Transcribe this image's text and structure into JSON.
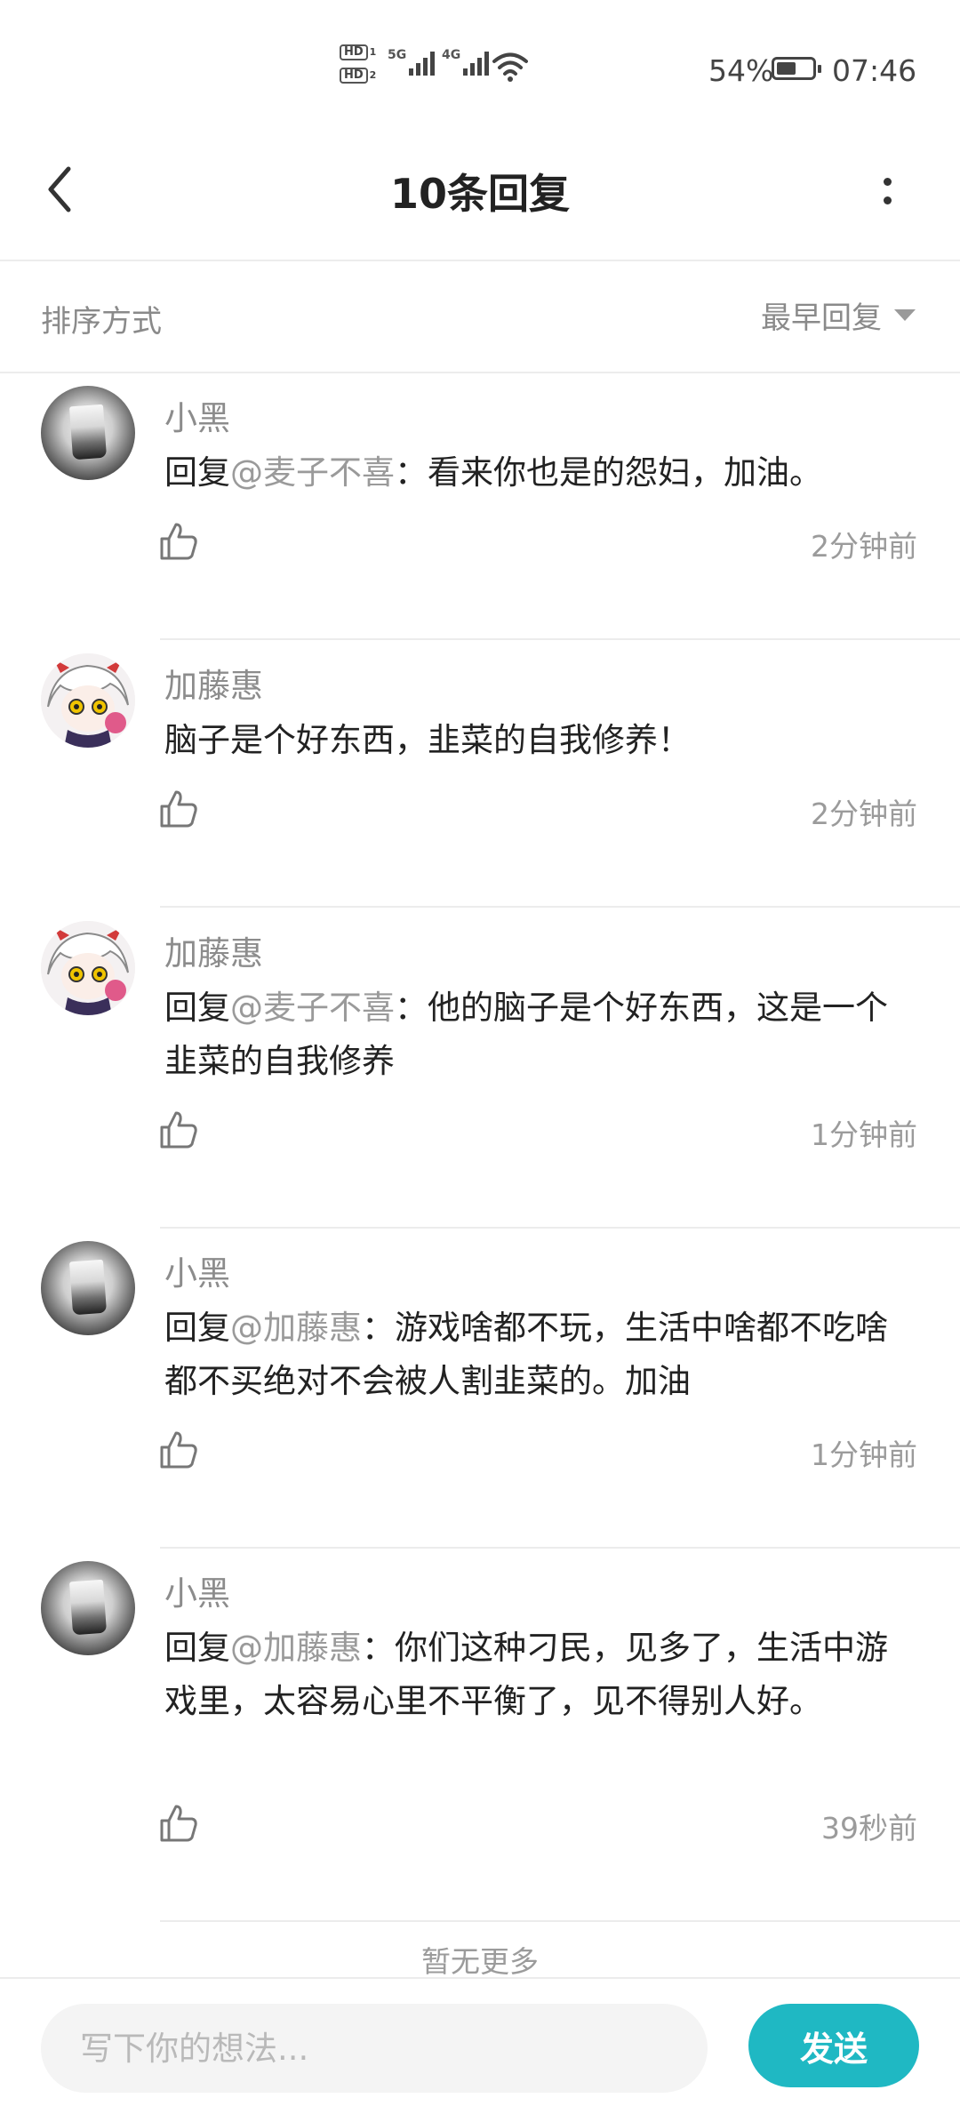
{
  "status_bar": {
    "hd1": "HD",
    "hd1_sub": "1",
    "hd2": "HD",
    "hd2_sub": "2",
    "network1": "5G",
    "network2": "4G",
    "battery_percent": "54%",
    "battery_level": 0.54,
    "time": "07:46"
  },
  "header": {
    "title": "10条回复",
    "back_icon": "chevron-left-icon",
    "more_icon": "more-vertical-icon"
  },
  "sort": {
    "label": "排序方式",
    "selected": "最早回复"
  },
  "comments": [
    {
      "name": "小黑",
      "avatar": "glass",
      "prefix": "回复",
      "mention": "@麦子不喜",
      "text": "：看来你也是的怨妇，加油。",
      "time": "2分钟前"
    },
    {
      "name": "加藤惠",
      "avatar": "anime",
      "prefix": "",
      "mention": "",
      "text": "脑子是个好东西，韭菜的自我修养！",
      "time": "2分钟前"
    },
    {
      "name": "加藤惠",
      "avatar": "anime",
      "prefix": "回复",
      "mention": "@麦子不喜",
      "text": "：他的脑子是个好东西，这是一个韭菜的自我修养",
      "time": "1分钟前"
    },
    {
      "name": "小黑",
      "avatar": "glass",
      "prefix": "回复",
      "mention": "@加藤惠",
      "text": "：游戏啥都不玩，生活中啥都不吃啥都不买绝对不会被人割韭菜的。加油",
      "time": "1分钟前"
    },
    {
      "name": "小黑",
      "avatar": "glass",
      "prefix": "回复",
      "mention": "@加藤惠",
      "text": "：你们这种刁民，见多了，生活中游戏里，太容易心里不平衡了，见不得别人好。",
      "time": "39秒前"
    }
  ],
  "footer": {
    "end_text": "暂无更多"
  },
  "input_bar": {
    "placeholder": "写下你的想法...",
    "value": "",
    "send_label": "发送"
  },
  "colors": {
    "accent": "#1fb8c3",
    "muted_text": "#8c8c8c",
    "body_text": "#222222",
    "divider": "#ececec"
  }
}
